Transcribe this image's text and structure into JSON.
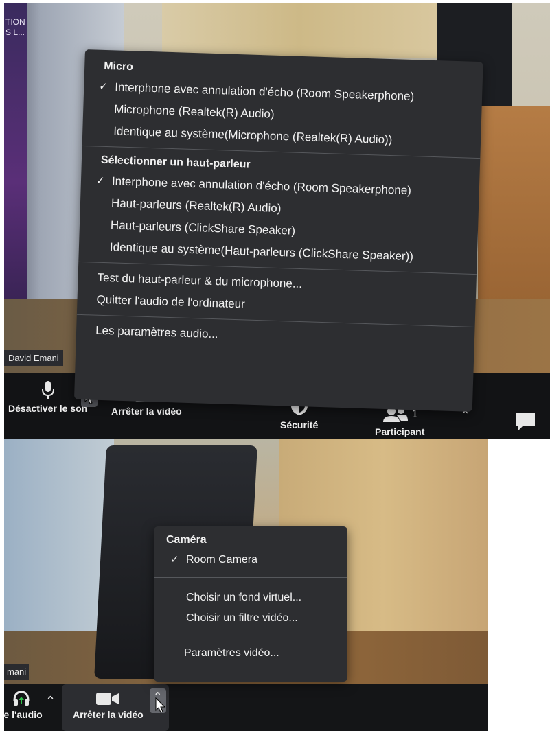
{
  "top_panel": {
    "side_text_line1": "TION",
    "side_text_line2": "S L...",
    "participant_name": "David Emani",
    "audio_menu": {
      "micro_heading": "Micro",
      "micro_items": [
        "Interphone avec annulation d'écho (Room Speakerphone)",
        "Microphone (Realtek(R) Audio)",
        "Identique au système(Microphone (Realtek(R) Audio))"
      ],
      "speaker_heading": "Sélectionner un haut-parleur",
      "speaker_items": [
        "Interphone avec annulation d'écho (Room Speakerphone)",
        "Haut-parleurs (Realtek(R) Audio)",
        "Haut-parleurs (ClickShare Speaker)",
        "Identique au système(Haut-parleurs (ClickShare Speaker))"
      ],
      "test_item": "Test du haut-parleur & du microphone...",
      "quit_item": "Quitter l'audio de l'ordinateur",
      "settings_item": "Les paramètres audio..."
    },
    "toolbar": {
      "mute_label": "Désactiver le son",
      "stop_video_label": "Arrêter la vidéo",
      "security_label": "Sécurité",
      "participants_count": "1",
      "participants_label": "Participant"
    }
  },
  "bottom_panel": {
    "participant_name": "mani",
    "camera_menu": {
      "heading": "Caméra",
      "camera_item": "Room Camera",
      "virtual_bg_item": "Choisir un fond virtuel...",
      "video_filter_item": "Choisir un filtre vidéo...",
      "video_settings_item": "Paramètres vidéo..."
    },
    "toolbar": {
      "join_audio_label": "re l'audio",
      "stop_video_label": "Arrêter la vidéo"
    }
  },
  "colors": {
    "menu_bg": "#2d2e31",
    "toolbar_bg": "#121315",
    "text": "#f1f1f1",
    "join_audio_green": "#2fbf4a"
  }
}
